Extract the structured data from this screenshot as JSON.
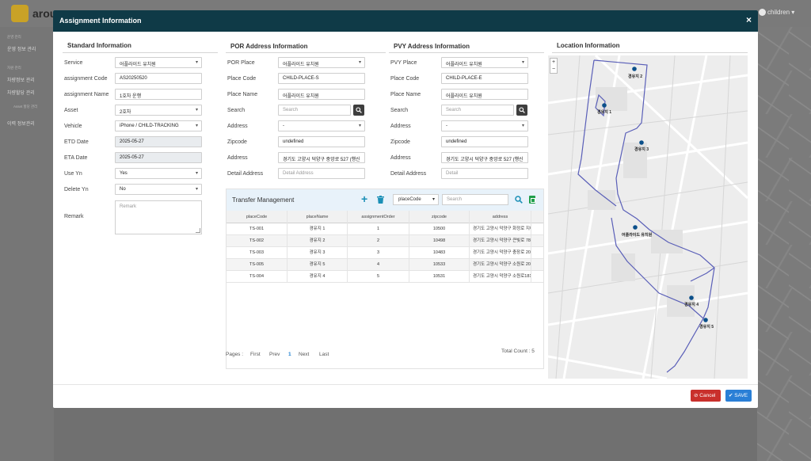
{
  "background": {
    "logo_text": "arou",
    "user": "children",
    "menu": [
      "운영 관리",
      "운영 정보 관리",
      "자원 관리",
      "차량정보 관리",
      "차량할당 관리",
      "Asset 할당 관리",
      "이력 정보관리"
    ]
  },
  "modal": {
    "title": "Assignment Information",
    "close": "×"
  },
  "standard": {
    "title": "Standard Information",
    "fields": [
      {
        "label": "Service",
        "value": "어플라이드 유치원",
        "type": "select"
      },
      {
        "label": "assignment Code",
        "value": "AS20250520",
        "type": "text"
      },
      {
        "label": "assignment Name",
        "value": "1호차 운행",
        "type": "text"
      },
      {
        "label": "Asset",
        "value": "2호차",
        "type": "select"
      },
      {
        "label": "Vehicle",
        "value": "iPhone / CHILD-TRACKING",
        "type": "select"
      },
      {
        "label": "ETD Date",
        "value": "2025-05-27",
        "type": "disabled"
      },
      {
        "label": "ETA Date",
        "value": "2025-05-27",
        "type": "disabled"
      },
      {
        "label": "Use Yn",
        "value": "Yes",
        "type": "select"
      },
      {
        "label": "Delete Yn",
        "value": "No",
        "type": "select"
      }
    ],
    "remark_label": "Remark",
    "remark_placeholder": "Remark"
  },
  "por": {
    "title": "POR Address Information",
    "fields": [
      {
        "label": "POR Place",
        "value": "어플라이드 유치원",
        "type": "select"
      },
      {
        "label": "Place Code",
        "value": "CHILD-PLACE-S",
        "type": "text"
      },
      {
        "label": "Place Name",
        "value": "어플라이드 유치원",
        "type": "text"
      },
      {
        "label": "Search",
        "value": "Search",
        "type": "search"
      },
      {
        "label": "Address",
        "value": "-",
        "type": "select"
      },
      {
        "label": "Zipcode",
        "value": "undefined",
        "type": "text"
      },
      {
        "label": "Address",
        "value": "경기도 고양시 덕양구 중앙로 527 (행신",
        "type": "text"
      },
      {
        "label": "Detail Address",
        "value": "Detail Address",
        "type": "placeholder"
      }
    ]
  },
  "pvy": {
    "title": "PVY Address Information",
    "fields": [
      {
        "label": "PVY Place",
        "value": "어플라이드 유치원",
        "type": "select"
      },
      {
        "label": "Place Code",
        "value": "CHILD-PLACE-E",
        "type": "text"
      },
      {
        "label": "Place Name",
        "value": "어플라이드 유치원",
        "type": "text"
      },
      {
        "label": "Search",
        "value": "Search",
        "type": "search"
      },
      {
        "label": "Address",
        "value": "-",
        "type": "select"
      },
      {
        "label": "Zipcode",
        "value": "undefined",
        "type": "text"
      },
      {
        "label": "Address",
        "value": "경기도 고양시 덕양구 중앙로 527 (행신",
        "type": "text"
      },
      {
        "label": "Detail Address",
        "value": "Detail",
        "type": "placeholder"
      }
    ]
  },
  "transfer": {
    "title": "Transfer Management",
    "filter_selected": "placeCode",
    "search_placeholder": "Search",
    "columns": [
      "placeCode",
      "placeName",
      "assignmentOrder",
      "zipcode",
      "address"
    ],
    "rows": [
      [
        "TS-001",
        "경유지 1",
        "1",
        "10500",
        "경기도 고양시 덕양구 화정로 지어"
      ],
      [
        "TS-002",
        "경유지 2",
        "2",
        "10498",
        "경기도 고양시 덕양구 큰빛로 78"
      ],
      [
        "TS-003",
        "경유지 3",
        "3",
        "10483",
        "경기도 고양시 덕양구 충장로 20"
      ],
      [
        "TS-005",
        "경유지 5",
        "4",
        "10533",
        "경기도 고양시 덕양구 소원로 20"
      ],
      [
        "TS-004",
        "경유지 4",
        "5",
        "10531",
        "경기도 고양시 덕양구 소원로181"
      ]
    ],
    "pager": {
      "label": "Pages :",
      "first": "First",
      "prev": "Prev",
      "current": "1",
      "next": "Next",
      "last": "Last"
    },
    "total": "Total Count : 5"
  },
  "location": {
    "title": "Location Information",
    "zoom_in": "+",
    "zoom_out": "−",
    "markers": [
      "경유지 2",
      "경유지 1",
      "경유지 3",
      "어플라이드 유치원",
      "경유지 4",
      "경유지 5"
    ]
  },
  "footer": {
    "cancel": "Cancel",
    "save": "SAVE"
  },
  "colors": {
    "header": "#0f3a47",
    "cancel": "#c9302c",
    "save": "#2a7fd6",
    "route": "#5a5fb8",
    "marker": "#0b4f8a"
  }
}
